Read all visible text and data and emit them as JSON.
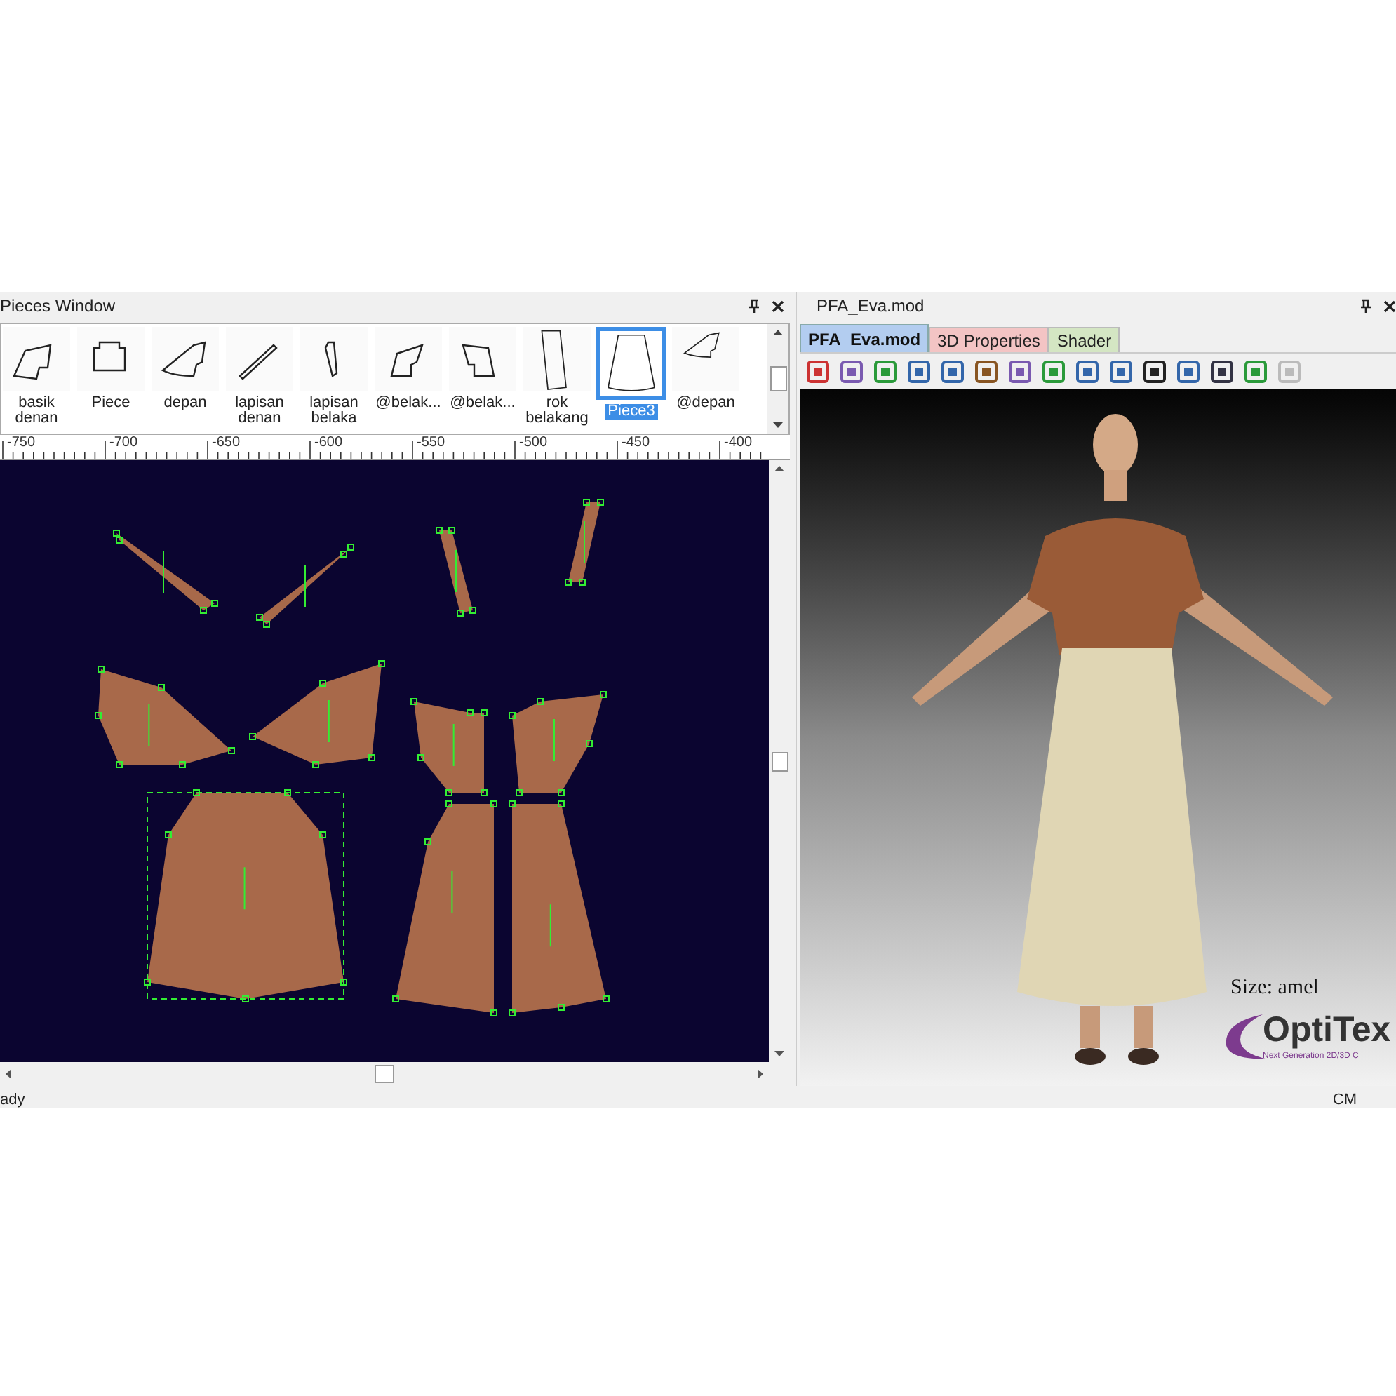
{
  "pieces_window": {
    "title": "Pieces Window",
    "pieces": [
      {
        "label": "basik denan",
        "selected": false
      },
      {
        "label": "Piece",
        "selected": false
      },
      {
        "label": "depan",
        "selected": false
      },
      {
        "label": "lapisan denan",
        "selected": false
      },
      {
        "label": "lapisan belaka",
        "selected": false
      },
      {
        "label": "@belak...",
        "selected": false
      },
      {
        "label": "@belak...",
        "selected": false
      },
      {
        "label": "rok belakang",
        "selected": false
      },
      {
        "label": "Piece3",
        "selected": true
      },
      {
        "label": "@depan",
        "selected": false
      }
    ],
    "ruler_ticks": [
      "-750",
      "-700",
      "-650",
      "-600",
      "-550",
      "-500",
      "-450",
      "-400"
    ]
  },
  "view_3d": {
    "title": "PFA_Eva.mod",
    "tabs": [
      {
        "label": "PFA_Eva.mod",
        "selected": true,
        "color": "#b3cdf0"
      },
      {
        "label": "3D Properties",
        "selected": false,
        "color": "#f3c4c4"
      },
      {
        "label": "Shader",
        "selected": false,
        "color": "#d4e6c3"
      }
    ],
    "size_label": "Size: amel",
    "logo": {
      "name": "OptiTex",
      "tagline": "Next Generation 2D/3D C"
    }
  },
  "status_bar": {
    "left": "ady",
    "right": "CM"
  }
}
